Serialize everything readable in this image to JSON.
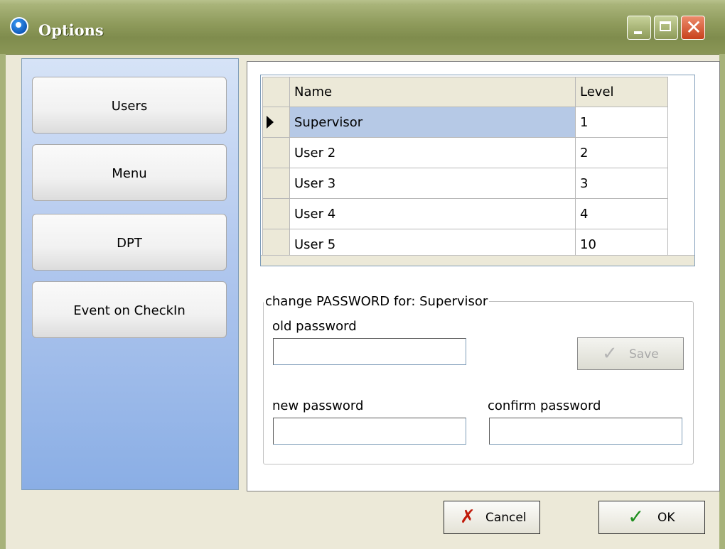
{
  "window": {
    "title": "Options",
    "titlebar_color": "#8e9a5b",
    "minimize_icon": "minimize-icon",
    "maximize_icon": "maximize-icon",
    "close_icon": "close-icon",
    "close_glyph": "✕"
  },
  "sidebar": {
    "items": [
      {
        "label": "Users"
      },
      {
        "label": "Menu"
      },
      {
        "label": "DPT"
      },
      {
        "label": "Event on CheckIn"
      }
    ]
  },
  "grid": {
    "columns": [
      "Name",
      "Level"
    ],
    "rows": [
      {
        "name": "Supervisor",
        "level": "1",
        "selected": true
      },
      {
        "name": "User 2",
        "level": "2",
        "selected": false
      },
      {
        "name": "User 3",
        "level": "3",
        "selected": false
      },
      {
        "name": "User 4",
        "level": "4",
        "selected": false
      },
      {
        "name": "User 5",
        "level": "10",
        "selected": false
      }
    ],
    "selection_color": "#b6c9e6"
  },
  "password_group": {
    "legend": "change PASSWORD for: Supervisor",
    "old_label": "old password",
    "old_value": "",
    "new_label": "new password",
    "new_value": "",
    "confirm_label": "confirm password",
    "confirm_value": "",
    "save_label": "Save",
    "save_icon": "checkmark-icon",
    "save_enabled": false
  },
  "footer": {
    "cancel_label": "Cancel",
    "cancel_icon": "x-icon",
    "ok_label": "OK",
    "ok_icon": "checkmark-icon"
  }
}
